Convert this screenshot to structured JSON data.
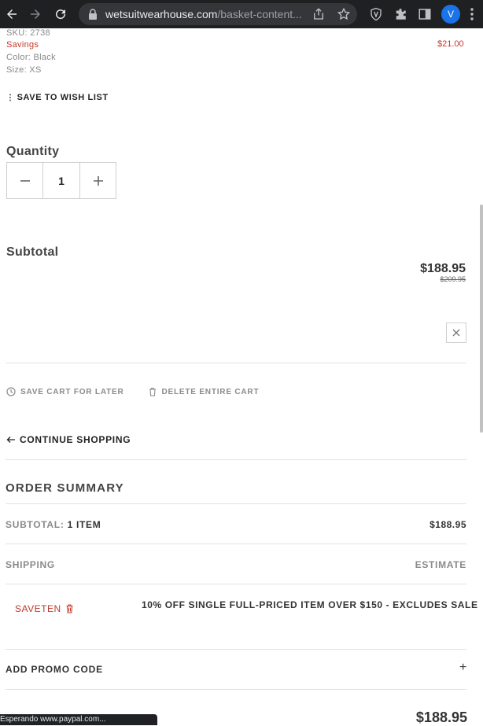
{
  "browser": {
    "url_main": "wetsuitwearhouse.com",
    "url_rest": "/basket-content...",
    "profile_initial": "V"
  },
  "product": {
    "sku": "SKU: 2738",
    "savings_label": "Savings",
    "savings_value": "$21.00",
    "color": "Color: Black",
    "size": "Size: XS",
    "save_wishlist": "SAVE TO WISH LIST"
  },
  "quantity": {
    "label": "Quantity",
    "value": "1"
  },
  "subtotal": {
    "label": "Subtotal",
    "price": "$188.95",
    "original_price": "$209.95"
  },
  "cart_actions": {
    "save_cart": "SAVE CART FOR LATER",
    "delete_cart": "DELETE ENTIRE CART"
  },
  "continue_shopping": "CONTINUE SHOPPING",
  "order_summary": {
    "title": "ORDER SUMMARY",
    "subtotal_label": "SUBTOTAL:",
    "subtotal_items": "1 ITEM",
    "subtotal_value": "$188.95",
    "shipping_label": "SHIPPING",
    "shipping_value": "ESTIMATE",
    "promo_code": "SAVETEN",
    "promo_description": "10% OFF SINGLE FULL-PRICED ITEM OVER $150 - EXCLUDES SALE",
    "add_promo_label": "ADD PROMO CODE",
    "add_promo_symbol": "+",
    "total": "$188.95"
  },
  "status_bar": "Esperando www.paypal.com..."
}
